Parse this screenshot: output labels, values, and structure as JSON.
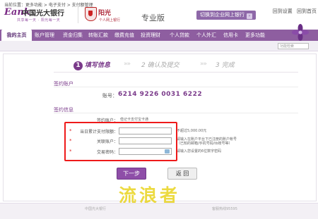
{
  "header": {
    "logo_mark": "Eank",
    "bank_name": "中国光大银行",
    "slogan": "共享每一天 · 阳光每一天",
    "brand": "阳光",
    "brand_sub": "个人网上银行",
    "edition": "专业版",
    "corp_link": "切换到企业网上银行",
    "top_links": [
      "回到设置",
      "回到首页"
    ]
  },
  "nav": {
    "items": [
      "我的主页",
      "账户管理",
      "资金归集",
      "转账汇款",
      "缴费充值",
      "投资理财",
      "个人贷款",
      "个人外汇",
      "信用卡",
      "更多功能"
    ],
    "active_index": 0
  },
  "breadcrumb": {
    "text": "当前位置：更多功能 > 电子支付 > 支付额管理",
    "search_placeholder": "功能检索"
  },
  "steps": {
    "items": [
      {
        "num": "1",
        "label": "填写信息"
      },
      {
        "num": "2",
        "label": "确认及提交"
      },
      {
        "num": "3",
        "label": "完成"
      }
    ],
    "current": 1
  },
  "account_section": {
    "title": "签约账户",
    "account_label": "账号：",
    "account_number": "6214 9226 0031 6222"
  },
  "info_section": {
    "title": "签约信息",
    "signed_account_label": "签约账户：",
    "signed_account_value": "借记卡支付宝卡通"
  },
  "form": {
    "rows": [
      {
        "label": "当日累计支付限额：",
        "value": "",
        "note": "不超过5,000.00元",
        "note2": ""
      },
      {
        "label": "关联账户：",
        "value": "",
        "note": "请输入在账户平台下已注册的账户帐号",
        "note2": "（已知的邮箱/手机号码/tb账号等）"
      },
      {
        "label": "交易密码：",
        "value": "",
        "note": "请输入您设置的6位数字密码",
        "note2": ""
      }
    ]
  },
  "buttons": {
    "next": "下一步",
    "back": "返 回"
  },
  "watermark": "流浪者",
  "footer": {
    "left": "中国光大银行",
    "right": "客服热线95595"
  },
  "colors": {
    "brand_purple": "#8e5ea0",
    "accent_purple": "#7a3a8a",
    "highlight_red": "#ee1a1a",
    "watermark_yellow": "#e9d41f"
  }
}
